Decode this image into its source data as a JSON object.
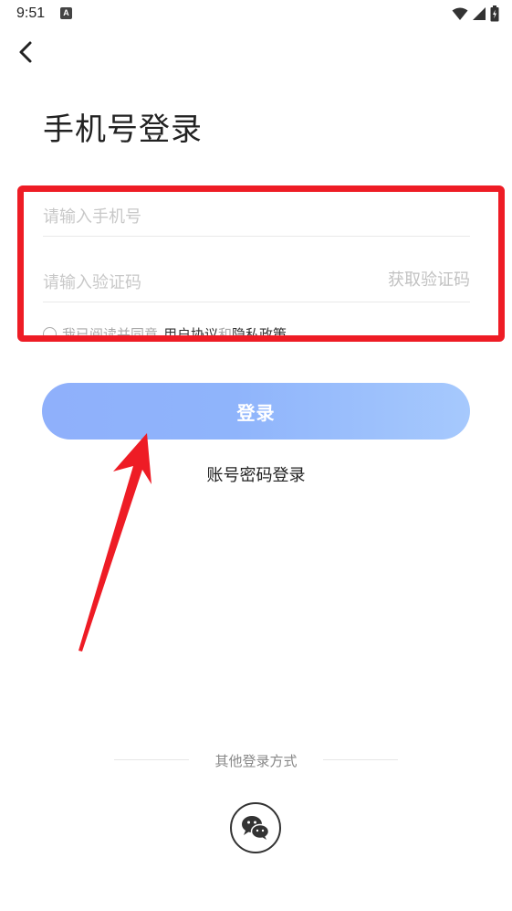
{
  "status_bar": {
    "time": "9:51",
    "a_badge": "A",
    "icons": [
      "wifi-icon",
      "signal-icon",
      "battery-icon"
    ]
  },
  "page": {
    "title": "手机号登录",
    "phone_placeholder": "请输入手机号",
    "code_placeholder": "请输入验证码",
    "get_code": "获取验证码",
    "agreement": {
      "prefix": "我已阅读并同意",
      "terms": "用户协议",
      "and": "和",
      "privacy": "隐私政策"
    },
    "login_button": "登录",
    "password_login": "账号密码登录",
    "other_methods": "其他登录方式"
  },
  "colors": {
    "annotation": "#ee1c25",
    "button_start": "#8fb0fb",
    "button_end": "#a6c9fd"
  }
}
